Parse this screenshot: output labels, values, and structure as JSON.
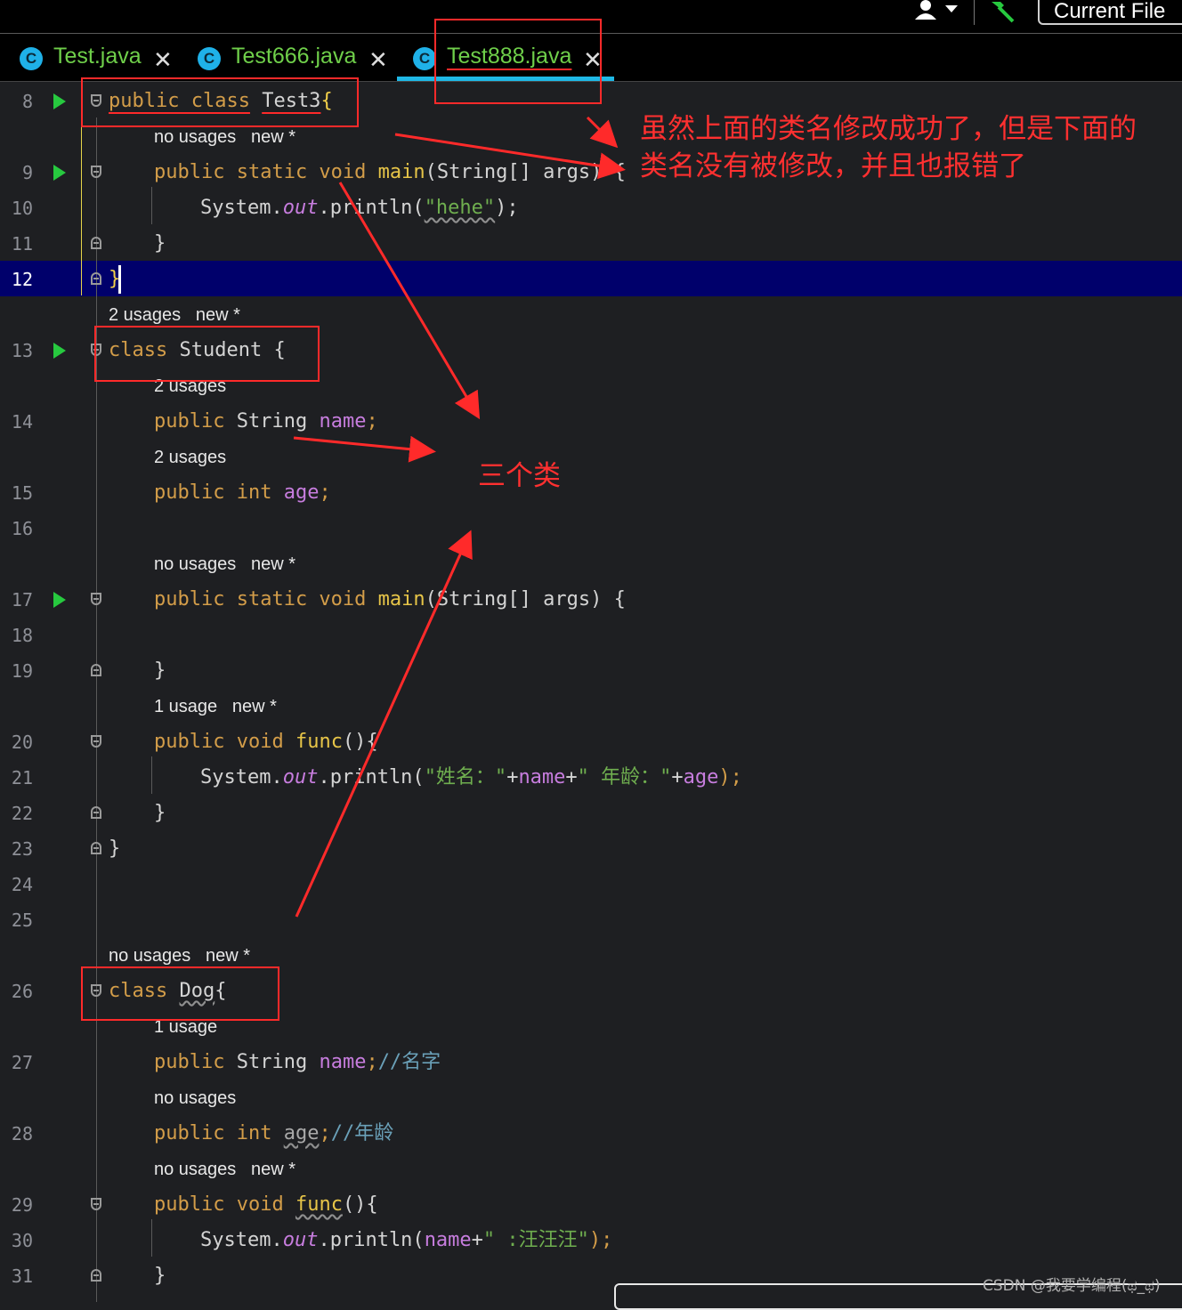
{
  "toolbar": {
    "run_config": "Current File"
  },
  "tabs": [
    {
      "label": "Test.java",
      "active": false
    },
    {
      "label": "Test666.java",
      "active": false
    },
    {
      "label": "Test888.java",
      "active": true
    }
  ],
  "code_lines": {
    "l8": {
      "num": "8",
      "kw": "public class",
      "name": "Test3",
      "brace": "{"
    },
    "h1": "no usages   new *",
    "l9": {
      "num": "9",
      "kw": "public static void",
      "fn": "main",
      "rest": "(String[] args) {"
    },
    "l10": {
      "num": "10",
      "pre": "System.",
      "out": "out",
      "mid": ".println(",
      "str": "\"hehe\"",
      "end": ");"
    },
    "l11": {
      "num": "11",
      "text": "}"
    },
    "l12": {
      "num": "12",
      "text": "}"
    },
    "h2": "2 usages   new *",
    "l13": {
      "num": "13",
      "kw": "class",
      "name": " Student {"
    },
    "h3": "2 usages",
    "l14": {
      "num": "14",
      "kw": "public",
      "type": " String ",
      "fld": "name",
      "end": ";"
    },
    "h4": "2 usages",
    "l15": {
      "num": "15",
      "kw": "public int",
      "fld": "age",
      "end": ";"
    },
    "l16": {
      "num": "16"
    },
    "h5": "no usages   new *",
    "l17": {
      "num": "17",
      "kw": "public static void",
      "fn": "main",
      "rest": "(String[] args) {"
    },
    "l18": {
      "num": "18"
    },
    "l19": {
      "num": "19",
      "text": "}"
    },
    "h6": "1 usage   new *",
    "l20": {
      "num": "20",
      "kw": "public void",
      "fn": "func",
      "rest": "(){"
    },
    "l21": {
      "num": "21",
      "pre": "System.",
      "out": "out",
      "mid": ".println(",
      "s1": "\"姓名：\"",
      "p1": "+",
      "f1": "name",
      "p2": "+",
      "s2": "\" 年龄：\"",
      "p3": "+",
      "f2": "age",
      "end": ");"
    },
    "l22": {
      "num": "22",
      "text": "}"
    },
    "l23": {
      "num": "23",
      "text": "}"
    },
    "l24": {
      "num": "24"
    },
    "l25": {
      "num": "25"
    },
    "h7": "no usages   new *",
    "l26": {
      "num": "26",
      "kw": "class",
      "name": "Dog",
      "brace": "{"
    },
    "h8": "1 usage",
    "l27": {
      "num": "27",
      "kw": "public",
      "type": " String ",
      "fld": "name",
      "end": ";",
      "cmt": "//名字"
    },
    "h9": "no usages",
    "l28": {
      "num": "28",
      "kw": "public int",
      "fld": "age",
      "end": ";",
      "cmt": "//年龄"
    },
    "h10": "no usages   new *",
    "l29": {
      "num": "29",
      "kw": "public void",
      "fn": "func",
      "rest": "(){"
    },
    "l30": {
      "num": "30",
      "pre": "System.",
      "out": "out",
      "mid": ".println(",
      "f1": "name",
      "p1": "+",
      "s1": "\" :汪汪汪\"",
      "end": ");"
    },
    "l31": {
      "num": "31",
      "text": "}"
    }
  },
  "annotations": {
    "note_line1": "虽然上面的类名修改成功了，但是下面的",
    "note_line2": "类名没有被修改，并且也报错了",
    "three_classes": "三个类"
  },
  "watermark": "CSDN @我要学编程(ಥ_ಥ)",
  "colors": {
    "background": "#1e1f22",
    "caret_line": "#00006b",
    "annotation": "#ff2a2a",
    "tab_text": "#6fcf4a",
    "keyword": "#d39d49"
  }
}
